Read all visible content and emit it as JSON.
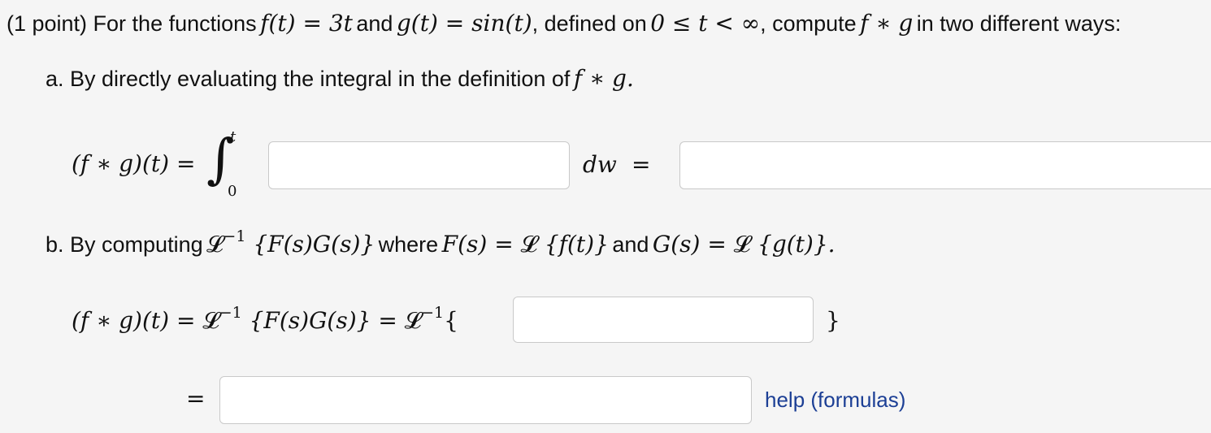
{
  "problem": {
    "intro_prefix": "(1 point) For the functions",
    "f_def": "f(t) = 3t",
    "and_1": "and",
    "g_def": "g(t) = sin(t)",
    "defined_on": ", defined on",
    "domain": "0 ≤ t < ∞",
    "compute": ", compute",
    "conv": "f ∗ g",
    "ways": "in two different ways:"
  },
  "part_a": {
    "text": "a. By directly evaluating the integral in the definition of",
    "conv": "f ∗ g.",
    "lhs": "(f ∗ g)(t) =",
    "integral_sign": "∫",
    "upper_limit": "t",
    "lower_limit": "0",
    "dw": "dw",
    "equals": "=",
    "integrand_value": "",
    "result_value": ""
  },
  "part_b": {
    "text_prefix": "b. By computing",
    "inv_laplace": "𝓛",
    "inv_exp": "−1",
    "braced_product": "{F(s)G(s)}",
    "where": "where",
    "F_lhs": "F(s) = ",
    "laplace": "𝓛",
    "F_rhs": "{f(t)}",
    "and": "and",
    "G_lhs": "G(s) = ",
    "G_rhs": "{g(t)}.",
    "eq_lhs": "(f ∗ g)(t) = ",
    "eq_mid": "{F(s)G(s)} = ",
    "open_brace": "{",
    "close_brace": "}",
    "equals": "=",
    "transform_value": "",
    "result_value": ""
  },
  "help": {
    "label": "help (formulas)"
  }
}
